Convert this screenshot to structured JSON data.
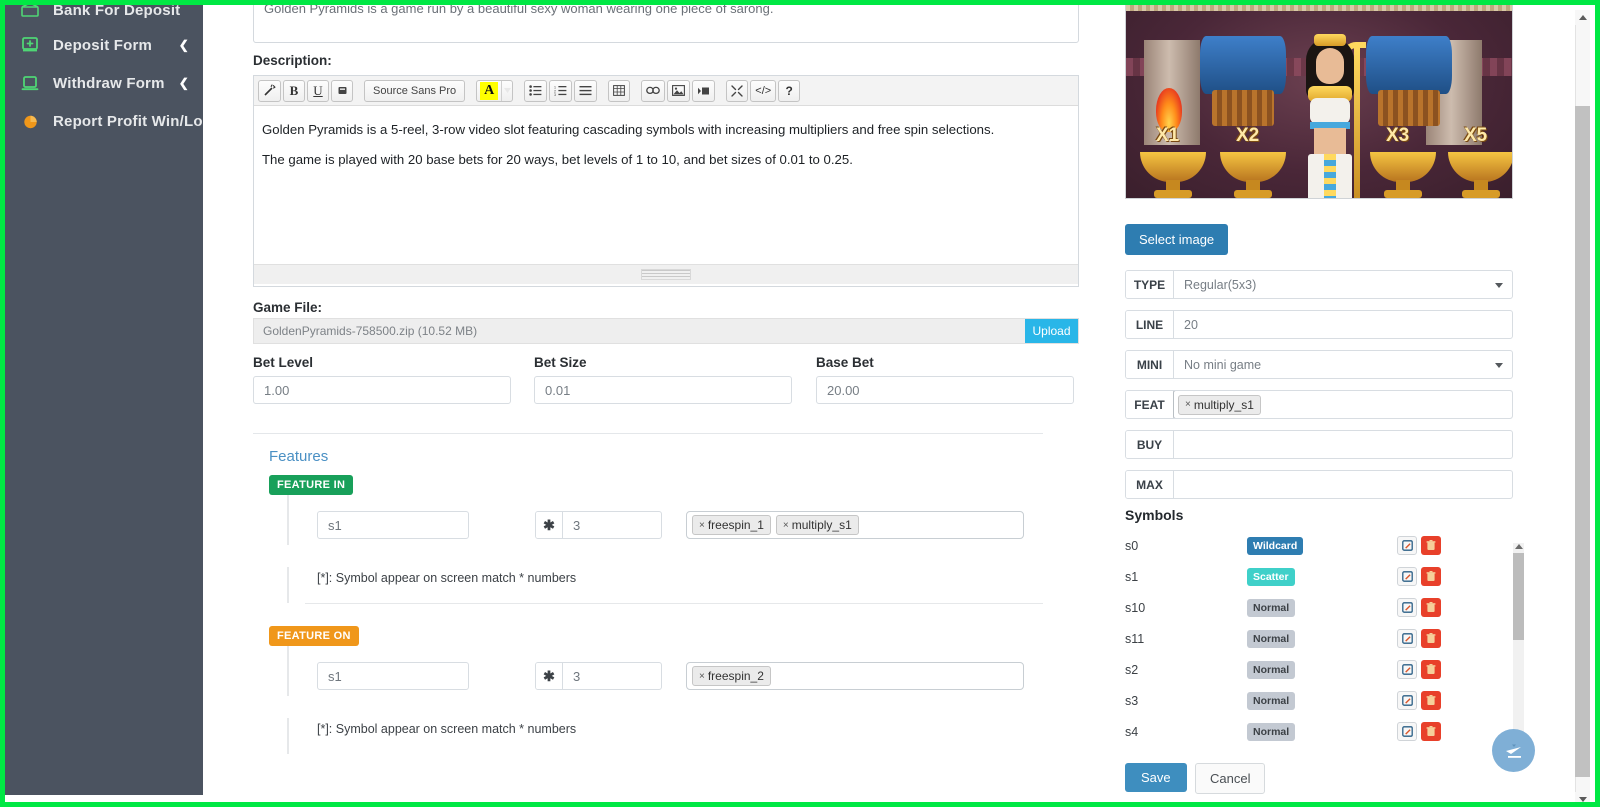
{
  "sidebar": {
    "items": [
      {
        "label": "Bank For Deposit",
        "icon": "bank-icon",
        "arrow": ""
      },
      {
        "label": "Deposit Form",
        "icon": "deposit-box-icon",
        "arrow": "❮"
      },
      {
        "label": "Withdraw Form",
        "icon": "monitor-icon",
        "arrow": "❮"
      },
      {
        "label": "Report Profit Win/Lose",
        "icon": "pie-chart-icon",
        "arrow": ""
      }
    ]
  },
  "main": {
    "short_description": "Golden Pyramids is a game run by a beautiful sexy woman wearing one piece of sarong.",
    "description_label": "Description:",
    "editor": {
      "font_name": "Source Sans Pro",
      "buttons": [
        {
          "name": "magic-wand-icon",
          "glyph": "✨"
        },
        {
          "name": "bold-icon",
          "glyph": "B"
        },
        {
          "name": "underline-icon",
          "glyph": "U"
        },
        {
          "name": "remove-format-icon",
          "glyph": "▰"
        },
        {
          "name": "bulleted-list-icon",
          "glyph": "☰"
        },
        {
          "name": "numbered-list-icon",
          "glyph": "⒈"
        },
        {
          "name": "align-icon",
          "glyph": "≡"
        },
        {
          "name": "table-icon",
          "glyph": "▦"
        },
        {
          "name": "link-icon",
          "glyph": "⛓"
        },
        {
          "name": "image-icon",
          "glyph": "🖼"
        },
        {
          "name": "media-icon",
          "glyph": "▶▪"
        },
        {
          "name": "maximize-icon",
          "glyph": "⤢"
        },
        {
          "name": "source-code-icon",
          "glyph": "</>"
        },
        {
          "name": "help-icon",
          "glyph": "?"
        }
      ],
      "paragraphs": [
        "Golden Pyramids is a 5-reel, 3-row video slot featuring cascading symbols with increasing multipliers and free spin selections.",
        "The game is played with 20 base bets for 20 ways, bet levels of 1 to 10, and bet sizes of 0.01 to 0.25."
      ]
    },
    "game_file": {
      "label": "Game File:",
      "file_name": "GoldenPyramids-758500.zip (10.52 MB)",
      "upload_label": "Upload"
    },
    "bet_fields": [
      {
        "label": "Bet Level",
        "value": "1.00"
      },
      {
        "label": "Bet Size",
        "value": "0.01"
      },
      {
        "label": "Base Bet",
        "value": "20.00"
      }
    ],
    "features": {
      "title": "Features",
      "note": "[*]: Symbol appear on screen match * numbers",
      "blocks": [
        {
          "badge": "FEATURE IN",
          "badge_style": "in",
          "symbol": "s1",
          "operator": "✱",
          "count": "3",
          "tags": [
            "freespin_1",
            "multiply_s1"
          ]
        },
        {
          "badge": "FEATURE ON",
          "badge_style": "on",
          "symbol": "s1",
          "operator": "✱",
          "count": "3",
          "tags": [
            "freespin_2"
          ]
        }
      ]
    }
  },
  "right": {
    "game_image": {
      "alt": "Golden Pyramids slot artwork",
      "multipliers": [
        "X1",
        "X2",
        "X3",
        "X5"
      ]
    },
    "select_image_label": "Select image",
    "properties": [
      {
        "key": "TYPE",
        "value": "Regular(5x3)",
        "control": "select"
      },
      {
        "key": "LINE",
        "value": "20",
        "control": "input"
      },
      {
        "key": "MINI",
        "value": "No mini game",
        "control": "select"
      },
      {
        "key": "FEAT",
        "value": "",
        "control": "tags",
        "tags": [
          "multiply_s1"
        ]
      },
      {
        "key": "BUY",
        "value": "",
        "control": "input"
      },
      {
        "key": "MAX",
        "value": "",
        "control": "input"
      }
    ],
    "symbols_title": "Symbols",
    "symbols": [
      {
        "name": "s0",
        "type": "Wildcard",
        "type_class": "b-wildcard"
      },
      {
        "name": "s1",
        "type": "Scatter",
        "type_class": "b-scatter"
      },
      {
        "name": "s10",
        "type": "Normal",
        "type_class": "b-normal"
      },
      {
        "name": "s11",
        "type": "Normal",
        "type_class": "b-normal"
      },
      {
        "name": "s2",
        "type": "Normal",
        "type_class": "b-normal"
      },
      {
        "name": "s3",
        "type": "Normal",
        "type_class": "b-normal"
      },
      {
        "name": "s4",
        "type": "Normal",
        "type_class": "b-normal"
      }
    ],
    "save_label": "Save",
    "cancel_label": "Cancel"
  },
  "colors": {
    "sidebar_bg": "#4b5360",
    "sidebar_icon_green": "#4fd675",
    "sidebar_icon_orange": "#f0971a",
    "capture_border": "#00e844",
    "upload_blue": "#29b6e8",
    "select_image_blue": "#2e7db1",
    "save_blue": "#3e8ebf",
    "feature_in_green": "#18a05a",
    "feature_on_orange": "#f0971a",
    "wildcard_blue": "#2e7db1",
    "scatter_teal": "#3fd0c9",
    "normal_grey": "#c3c9d2",
    "delete_red": "#e8402a",
    "features_title_blue": "#4a90c4",
    "fab_blue": "#7fafd6"
  }
}
